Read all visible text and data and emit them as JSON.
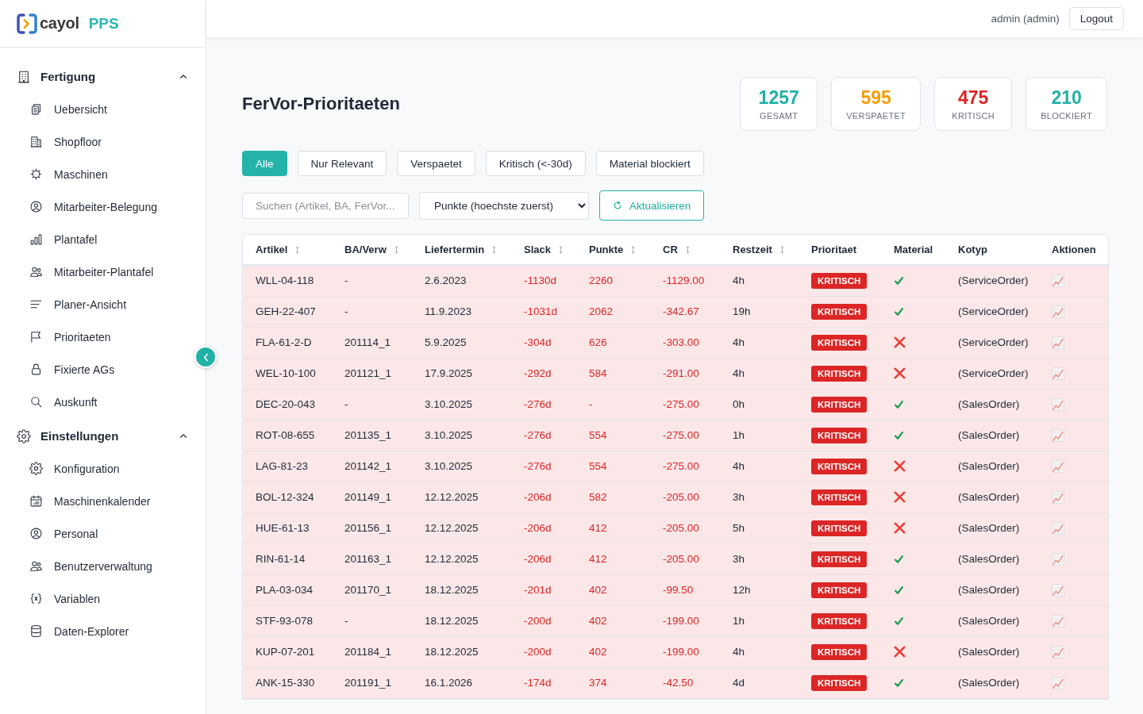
{
  "brand": {
    "name": "cayol",
    "product": "PPS"
  },
  "sidebar": {
    "sections": [
      {
        "title": "Fertigung",
        "expanded": true,
        "items": [
          {
            "label": "Uebersicht"
          },
          {
            "label": "Shopfloor"
          },
          {
            "label": "Maschinen"
          },
          {
            "label": "Mitarbeiter-Belegung"
          },
          {
            "label": "Plantafel"
          },
          {
            "label": "Mitarbeiter-Plantafel"
          },
          {
            "label": "Planer-Ansicht"
          },
          {
            "label": "Prioritaeten"
          },
          {
            "label": "Fixierte AGs"
          },
          {
            "label": "Auskunft"
          }
        ]
      },
      {
        "title": "Einstellungen",
        "expanded": true,
        "items": [
          {
            "label": "Konfiguration"
          },
          {
            "label": "Maschinenkalender"
          },
          {
            "label": "Personal"
          },
          {
            "label": "Benutzerverwaltung"
          },
          {
            "label": "Variablen"
          },
          {
            "label": "Daten-Explorer"
          }
        ]
      }
    ]
  },
  "topbar": {
    "user": "admin (admin)",
    "logout": "Logout"
  },
  "page": {
    "title": "FerVor-Prioritaeten"
  },
  "stats": [
    {
      "value": "1257",
      "label": "GESAMT",
      "color": "#22b1a7"
    },
    {
      "value": "595",
      "label": "VERSPAETET",
      "color": "#f39c0d"
    },
    {
      "value": "475",
      "label": "KRITISCH",
      "color": "#dc2626"
    },
    {
      "value": "210",
      "label": "BLOCKIERT",
      "color": "#22b1a7"
    }
  ],
  "filters": [
    {
      "label": "Alle",
      "selected": true
    },
    {
      "label": "Nur Relevant",
      "selected": false
    },
    {
      "label": "Verspaetet",
      "selected": false
    },
    {
      "label": "Kritisch (<-30d)",
      "selected": false
    },
    {
      "label": "Material blockiert",
      "selected": false
    }
  ],
  "search": {
    "placeholder": "Suchen (Artikel, BA, FerVor..."
  },
  "sort_select": {
    "value": "Punkte (hoechste zuerst)"
  },
  "refresh_button": {
    "label": "Aktualisieren"
  },
  "table": {
    "columns": [
      {
        "label": "Artikel",
        "sortable": true
      },
      {
        "label": "BA/Verw",
        "sortable": true
      },
      {
        "label": "Liefertermin",
        "sortable": true
      },
      {
        "label": "Slack",
        "sortable": true
      },
      {
        "label": "Punkte",
        "sortable": true
      },
      {
        "label": "CR",
        "sortable": true
      },
      {
        "label": "Restzeit",
        "sortable": true
      },
      {
        "label": "Prioritaet",
        "sortable": false
      },
      {
        "label": "Material",
        "sortable": false
      },
      {
        "label": "Kotyp",
        "sortable": false
      },
      {
        "label": "Aktionen",
        "sortable": false
      }
    ],
    "rows": [
      {
        "artikel": "WLL-04-118",
        "ba": "-",
        "liefertermin": "2.6.2023",
        "slack": "-1130d",
        "punkte": "2260",
        "cr": "-1129.00",
        "restzeit": "4h",
        "prioritaet": "KRITISCH",
        "critical": true,
        "material_ok": true,
        "kotyp": "(ServiceOrder)"
      },
      {
        "artikel": "GEH-22-407",
        "ba": "-",
        "liefertermin": "11.9.2023",
        "slack": "-1031d",
        "punkte": "2062",
        "cr": "-342.67",
        "restzeit": "19h",
        "prioritaet": "KRITISCH",
        "critical": true,
        "material_ok": true,
        "kotyp": "(ServiceOrder)"
      },
      {
        "artikel": "FLA-61-2-D",
        "ba": "201114_1",
        "liefertermin": "5.9.2025",
        "slack": "-304d",
        "punkte": "626",
        "cr": "-303.00",
        "restzeit": "4h",
        "prioritaet": "KRITISCH",
        "critical": true,
        "material_ok": false,
        "kotyp": "(ServiceOrder)"
      },
      {
        "artikel": "WEL-10-100",
        "ba": "201121_1",
        "liefertermin": "17.9.2025",
        "slack": "-292d",
        "punkte": "584",
        "cr": "-291.00",
        "restzeit": "4h",
        "prioritaet": "KRITISCH",
        "critical": true,
        "material_ok": false,
        "kotyp": "(ServiceOrder)"
      },
      {
        "artikel": "DEC-20-043",
        "ba": "-",
        "liefertermin": "3.10.2025",
        "slack": "-276d",
        "punkte": "-",
        "cr": "-275.00",
        "restzeit": "0h",
        "prioritaet": "KRITISCH",
        "critical": true,
        "material_ok": true,
        "kotyp": "(SalesOrder)"
      },
      {
        "artikel": "ROT-08-655",
        "ba": "201135_1",
        "liefertermin": "3.10.2025",
        "slack": "-276d",
        "punkte": "554",
        "cr": "-275.00",
        "restzeit": "1h",
        "prioritaet": "KRITISCH",
        "critical": true,
        "material_ok": true,
        "kotyp": "(SalesOrder)"
      },
      {
        "artikel": "LAG-81-23",
        "ba": "201142_1",
        "liefertermin": "3.10.2025",
        "slack": "-276d",
        "punkte": "554",
        "cr": "-275.00",
        "restzeit": "4h",
        "prioritaet": "KRITISCH",
        "critical": true,
        "material_ok": false,
        "kotyp": "(SalesOrder)"
      },
      {
        "artikel": "BOL-12-324",
        "ba": "201149_1",
        "liefertermin": "12.12.2025",
        "slack": "-206d",
        "punkte": "582",
        "cr": "-205.00",
        "restzeit": "3h",
        "prioritaet": "KRITISCH",
        "critical": true,
        "material_ok": false,
        "kotyp": "(SalesOrder)"
      },
      {
        "artikel": "HUE-61-13",
        "ba": "201156_1",
        "liefertermin": "12.12.2025",
        "slack": "-206d",
        "punkte": "412",
        "cr": "-205.00",
        "restzeit": "5h",
        "prioritaet": "KRITISCH",
        "critical": true,
        "material_ok": false,
        "kotyp": "(SalesOrder)"
      },
      {
        "artikel": "RIN-61-14",
        "ba": "201163_1",
        "liefertermin": "12.12.2025",
        "slack": "-206d",
        "punkte": "412",
        "cr": "-205.00",
        "restzeit": "3h",
        "prioritaet": "KRITISCH",
        "critical": true,
        "material_ok": true,
        "kotyp": "(SalesOrder)"
      },
      {
        "artikel": "PLA-03-034",
        "ba": "201170_1",
        "liefertermin": "18.12.2025",
        "slack": "-201d",
        "punkte": "402",
        "cr": "-99.50",
        "restzeit": "12h",
        "prioritaet": "KRITISCH",
        "critical": true,
        "material_ok": true,
        "kotyp": "(SalesOrder)"
      },
      {
        "artikel": "STF-93-078",
        "ba": "-",
        "liefertermin": "18.12.2025",
        "slack": "-200d",
        "punkte": "402",
        "cr": "-199.00",
        "restzeit": "1h",
        "prioritaet": "KRITISCH",
        "critical": true,
        "material_ok": true,
        "kotyp": "(SalesOrder)"
      },
      {
        "artikel": "KUP-07-201",
        "ba": "201184_1",
        "liefertermin": "18.12.2025",
        "slack": "-200d",
        "punkte": "402",
        "cr": "-199.00",
        "restzeit": "4h",
        "prioritaet": "KRITISCH",
        "critical": true,
        "material_ok": false,
        "kotyp": "(SalesOrder)"
      },
      {
        "artikel": "ANK-15-330",
        "ba": "201191_1",
        "liefertermin": "16.1.2026",
        "slack": "-174d",
        "punkte": "374",
        "cr": "-42.50",
        "restzeit": "4d",
        "prioritaet": "KRITISCH",
        "critical": true,
        "material_ok": true,
        "kotyp": "(SalesOrder)"
      }
    ]
  }
}
